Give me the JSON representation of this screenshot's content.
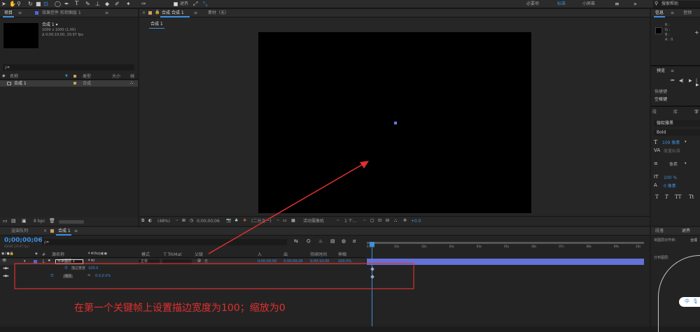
{
  "colors": {
    "accent": "#3d8fe0",
    "annotation": "#e0302f",
    "layer_bar": "#6272d8",
    "point": "#6979e6"
  },
  "toolbar": {
    "align_label": "对齐",
    "workspaces": [
      "必要项",
      "标准",
      "小屏幕"
    ],
    "active_workspace": "标准",
    "search_placeholder": "搜索帮助"
  },
  "project": {
    "tab": "项目",
    "effects_tab": "效果控件 形状图层 1",
    "comp_name": "合成 1 ▾",
    "comp_size": "1000 x 1000 (1.00)",
    "comp_duration": "Δ 0;00;10;00, 29.97 fps",
    "search_placeholder": "ρ▾",
    "columns": [
      "名称",
      "类型",
      "大小",
      "帧"
    ],
    "items": [
      {
        "name": "合成 1",
        "type": "合成"
      }
    ],
    "bpc": "8 bpc"
  },
  "composition": {
    "tab": "合成 合成 1",
    "footage_tab": "素材（无）",
    "breadcrumb": "合成 1",
    "zoom": "(48%)",
    "timecode": "0;00;00;06",
    "resolution": "(二分之一)",
    "camera": "活动摄像机",
    "views": "1 个...",
    "exposure": "+0.0"
  },
  "right_panel": {
    "info_tab": "信息",
    "audio_tab": "音频",
    "info_lines": [
      "R :",
      "G :",
      "B :",
      "A : 0"
    ],
    "preview_tab": "预览",
    "shortcut_label": "快捷键",
    "shortcut_value": "空格键",
    "char_tabs": [
      "段",
      "库",
      "字"
    ],
    "font_name": "微软雅黑",
    "font_style": "Bold",
    "font_size": "109 像素",
    "tracking_label": "度量标准",
    "unit": "像素",
    "scale_v": "100 %",
    "baseline": "0 像素",
    "text_styles": [
      "T",
      "T",
      "TT",
      "Tt"
    ],
    "para_tab": "段落",
    "align_tab": "对齐",
    "align_to": "将图层对齐到:",
    "align_to_value": "合成",
    "distribute": "分布图层:"
  },
  "timeline": {
    "render_tab": "渲染队列",
    "comp_tab": "合成 1",
    "timecode": "0;00;00;06",
    "fps_note": "00006 (29.97 fps)",
    "search_placeholder": "ρ▾",
    "columns": [
      "源名称",
      "模式",
      "T TrkMat",
      "父级",
      "入",
      "出",
      "持续时间",
      "伸缩"
    ],
    "layer": {
      "index": "1",
      "name": "形状图层 1",
      "mode": "正常",
      "parent": "无",
      "in": "0;00;00;00",
      "out": "0;00;09;29",
      "duration": "0;00;10;00",
      "stretch": "100.0%"
    },
    "properties": [
      {
        "name": "描边宽度",
        "value": "100.0"
      },
      {
        "name": "缩放",
        "value": "0.0,0.0%"
      }
    ],
    "ruler_ticks": [
      "0:00s",
      "01s",
      "02s",
      "03s",
      "04s",
      "05s",
      "06s",
      "07s",
      "08s",
      "09s",
      "10s"
    ]
  },
  "annotation": {
    "text": "在第一个关键帧上设置描边宽度为100；缩放为0"
  },
  "ime": {
    "label": "中"
  }
}
